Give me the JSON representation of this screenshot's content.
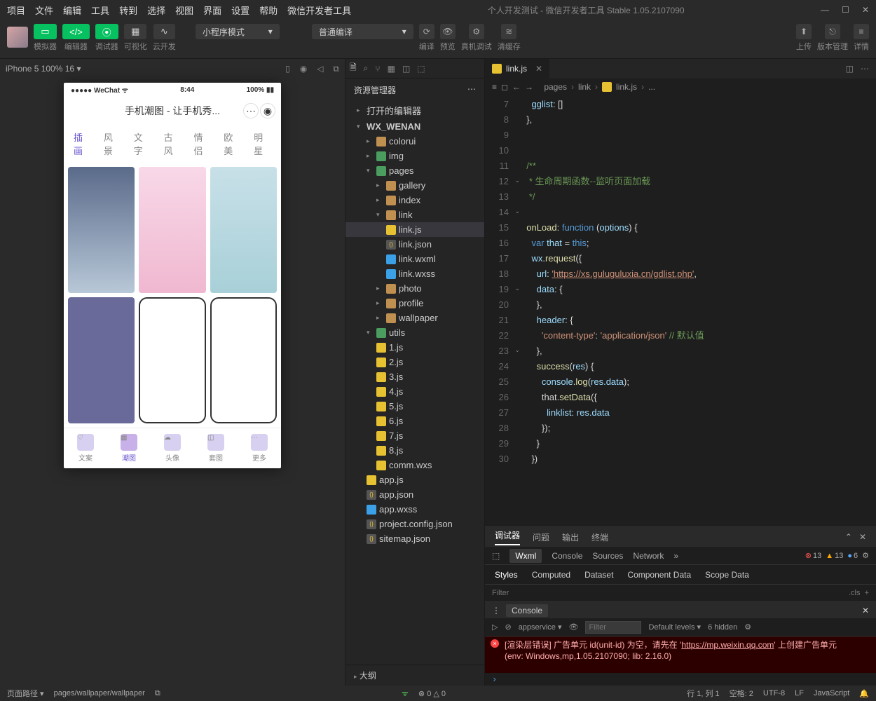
{
  "menu": [
    "项目",
    "文件",
    "编辑",
    "工具",
    "转到",
    "选择",
    "视图",
    "界面",
    "设置",
    "帮助",
    "微信开发者工具"
  ],
  "title": "个人开发测试 - 微信开发者工具 Stable 1.05.2107090",
  "toolbar": {
    "btn1": "模拟器",
    "btn2": "编辑器",
    "btn3": "调试器",
    "btn4": "可视化",
    "btn5": "云开发",
    "mode": "小程序模式",
    "compile": "普通编译",
    "act_compile": "编译",
    "act_preview": "预览",
    "act_debug": "真机调试",
    "act_cache": "清缓存",
    "upload": "上传",
    "version": "版本管理",
    "detail": "详情"
  },
  "sim": {
    "device": "iPhone 5 100% 16",
    "wechat": "●●●●● WeChat",
    "time": "8:44",
    "battery": "100%",
    "app_title": "手机潮图 - 让手机秀...",
    "tabs": [
      "插画",
      "风景",
      "文字",
      "古风",
      "情侣",
      "欧美",
      "明星"
    ],
    "nav": [
      "文案",
      "潮图",
      "头像",
      "套图",
      "更多"
    ]
  },
  "explorer": {
    "title": "资源管理器",
    "sections": {
      "open": "打开的编辑器",
      "proj": "WX_WENAN"
    },
    "tree": {
      "colorui": "colorui",
      "img": "img",
      "pages": "pages",
      "pages_children": [
        "gallery",
        "index",
        "link",
        "photo",
        "profile",
        "wallpaper"
      ],
      "link_children": [
        "link.js",
        "link.json",
        "link.wxml",
        "link.wxss"
      ],
      "utils": "utils",
      "utils_children": [
        "1.js",
        "2.js",
        "3.js",
        "4.js",
        "5.js",
        "6.js",
        "7.js",
        "8.js",
        "comm.wxs"
      ],
      "root": [
        "app.js",
        "app.json",
        "app.wxss",
        "project.config.json",
        "sitemap.json"
      ]
    },
    "outline": "大纲"
  },
  "editor": {
    "tab": "link.js",
    "crumbs": [
      "pages",
      "link",
      "link.js",
      "..."
    ],
    "lines": [
      "7",
      "8",
      "9",
      "10",
      "11",
      "12",
      "13",
      "14",
      "15",
      "16",
      "17",
      "18",
      "19",
      "20",
      "21",
      "22",
      "23",
      "24",
      "25",
      "26",
      "27",
      "28",
      "29",
      "30"
    ],
    "code": {
      "l7": "gglist",
      "l7b": ": []",
      "l12a": "/**",
      "l12b": " * 生命周期函数--监听页面加载",
      "l12c": " */",
      "onload": "onLoad",
      "fn": "function",
      "opts": "options",
      "varln": "var",
      "that": "that",
      "thisk": "this",
      "wx": "wx",
      "req": ".request",
      "url": "url",
      "urlval": "'https://xs.guluguluxia.cn/gdlist.php'",
      "data": "data",
      "header": "header",
      "ct": "'content-type'",
      "json": "'application/json'",
      "cm": "// 默认值",
      "success": "success",
      "res": "res",
      "console": "console",
      "log": ".log",
      "rd": "res.data",
      "setdata": "setData",
      "linklist": "linklist",
      "rdv": "res.data"
    }
  },
  "debugger": {
    "tabs": [
      "调试器",
      "问题",
      "输出",
      "终端"
    ],
    "panel": [
      "Wxml",
      "Console",
      "Sources",
      "Network"
    ],
    "badges": {
      "err": "13",
      "warn": "13",
      "info": "6"
    },
    "styles": [
      "Styles",
      "Computed",
      "Dataset",
      "Component Data",
      "Scope Data"
    ],
    "filter": "Filter",
    "cls": ".cls",
    "console": "Console",
    "context": "appservice",
    "levels": "Default levels",
    "hidden": "6 hidden",
    "err_line1": "[渲染层错误] 广告单元 id(unit-id) 为空，请先在 '",
    "err_url": "https://mp.weixin.qq.com",
    "err_line1b": "' 上创建广告单元",
    "err_line2": "(env: Windows,mp,1.05.2107090; lib: 2.16.0)"
  },
  "status": {
    "path_label": "页面路径",
    "path": "pages/wallpaper/wallpaper",
    "err": "0",
    "warn": "0",
    "line": "行 1, 列 1",
    "spaces": "空格: 2",
    "enc": "UTF-8",
    "eol": "LF",
    "lang": "JavaScript"
  }
}
